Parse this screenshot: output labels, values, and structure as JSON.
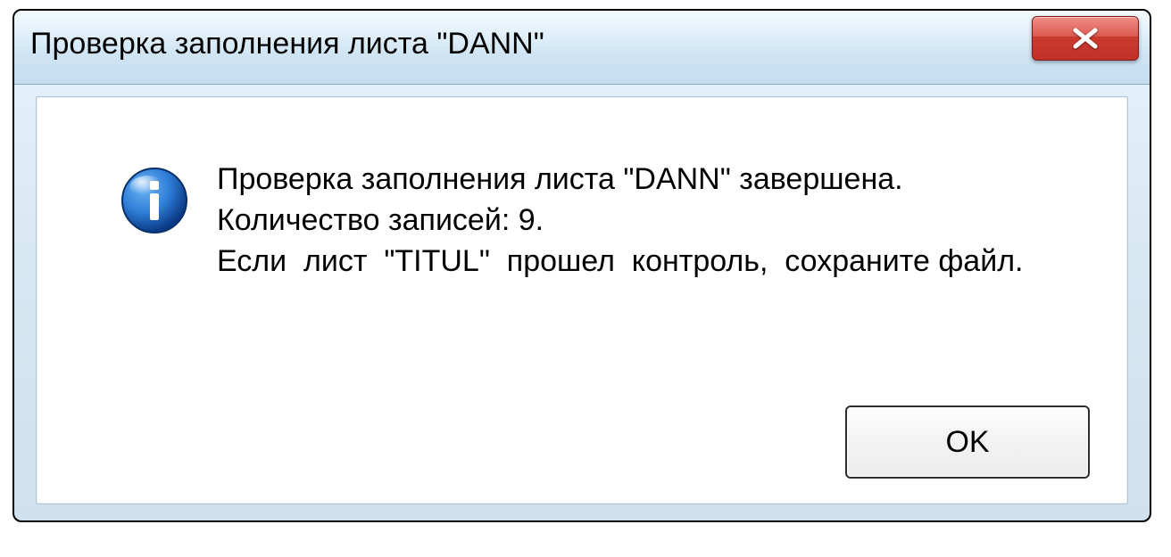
{
  "dialog": {
    "title": "Проверка заполнения листа \"DANN\"",
    "close_glyph": "✕",
    "icon": "info-icon",
    "message": {
      "line1": "Проверка заполнения листа \"DANN\" завершена.",
      "line2": "Количество записей: 9.",
      "line3": "Если  лист  \"TITUL\"  прошел  контроль,  сохраните файл."
    },
    "ok_label": "OK"
  }
}
